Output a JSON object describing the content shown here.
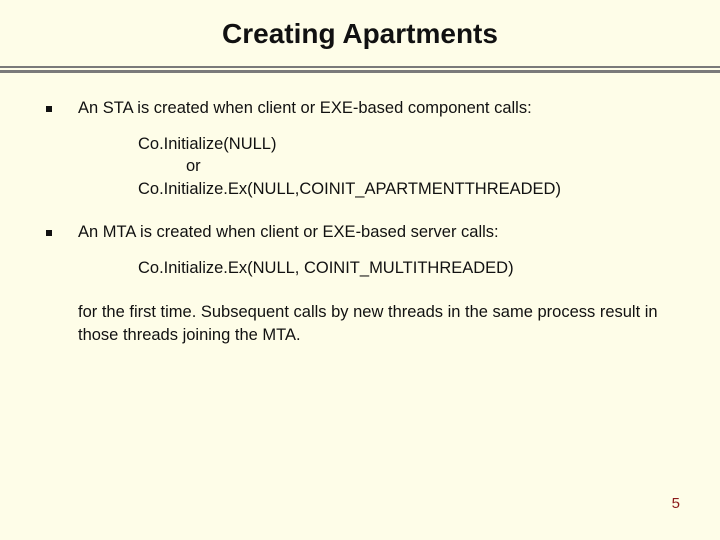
{
  "title": "Creating Apartments",
  "bullets": [
    {
      "text": "An STA is created when client or EXE-based component calls:",
      "code": [
        {
          "text": "Co.Initialize(NULL)",
          "indent": false
        },
        {
          "text": "or",
          "indent": true
        },
        {
          "text": "Co.Initialize.Ex(NULL,COINIT_APARTMENTTHREADED)",
          "indent": false
        }
      ]
    },
    {
      "text": "An MTA is created when client or EXE-based server calls:",
      "code": [
        {
          "text": "Co.Initialize.Ex(NULL, COINIT_MULTITHREADED)",
          "indent": false
        }
      ]
    }
  ],
  "trailing": "for the first time.  Subsequent calls by new threads in the same process result in those threads joining the MTA.",
  "page_number": "5"
}
